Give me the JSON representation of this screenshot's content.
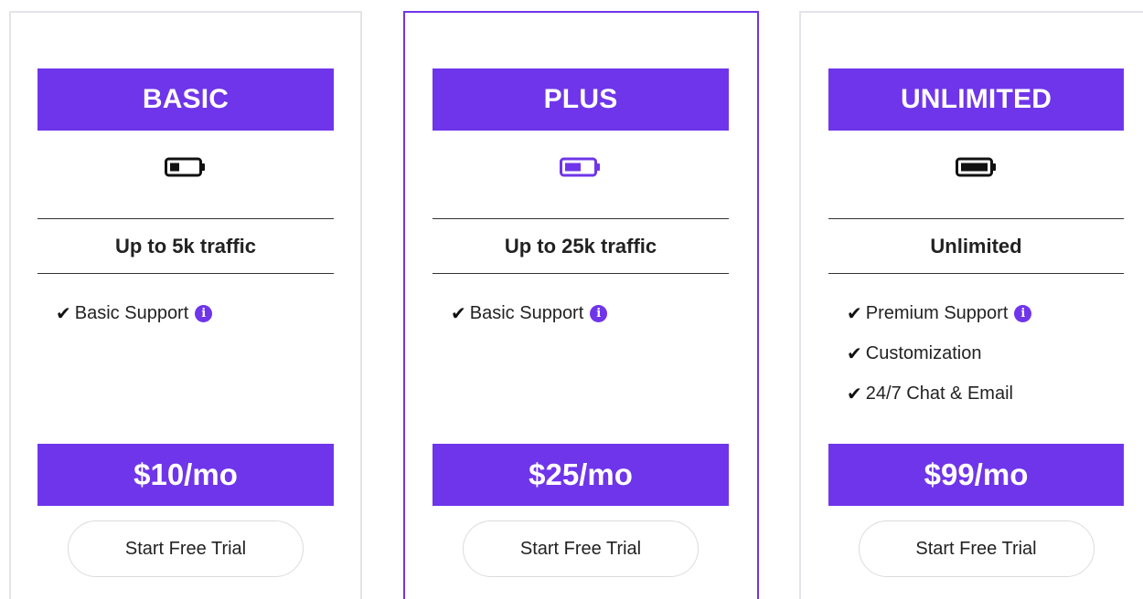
{
  "plans": [
    {
      "name": "BASIC",
      "battery_icon": "battery-low-icon",
      "traffic": "Up to 5k traffic",
      "features": [
        {
          "text": "Basic Support",
          "info": true
        }
      ],
      "price": "$10/mo",
      "cta": "Start Free Trial",
      "featured": false
    },
    {
      "name": "PLUS",
      "battery_icon": "battery-half-icon",
      "traffic": "Up to 25k traffic",
      "features": [
        {
          "text": "Basic Support",
          "info": true
        }
      ],
      "price": "$25/mo",
      "cta": "Start Free Trial",
      "featured": true
    },
    {
      "name": "UNLIMITED",
      "battery_icon": "battery-full-icon",
      "traffic": "Unlimited",
      "features": [
        {
          "text": "Premium Support",
          "info": true
        },
        {
          "text": "Customization",
          "info": false
        },
        {
          "text": "24/7 Chat & Email",
          "info": false
        }
      ],
      "price": "$99/mo",
      "cta": "Start Free Trial",
      "featured": false
    }
  ],
  "icons": {
    "check": "✔",
    "info": "i"
  },
  "colors": {
    "accent": "#6f35ea",
    "border": "#e2e4e7",
    "text": "#222222"
  }
}
